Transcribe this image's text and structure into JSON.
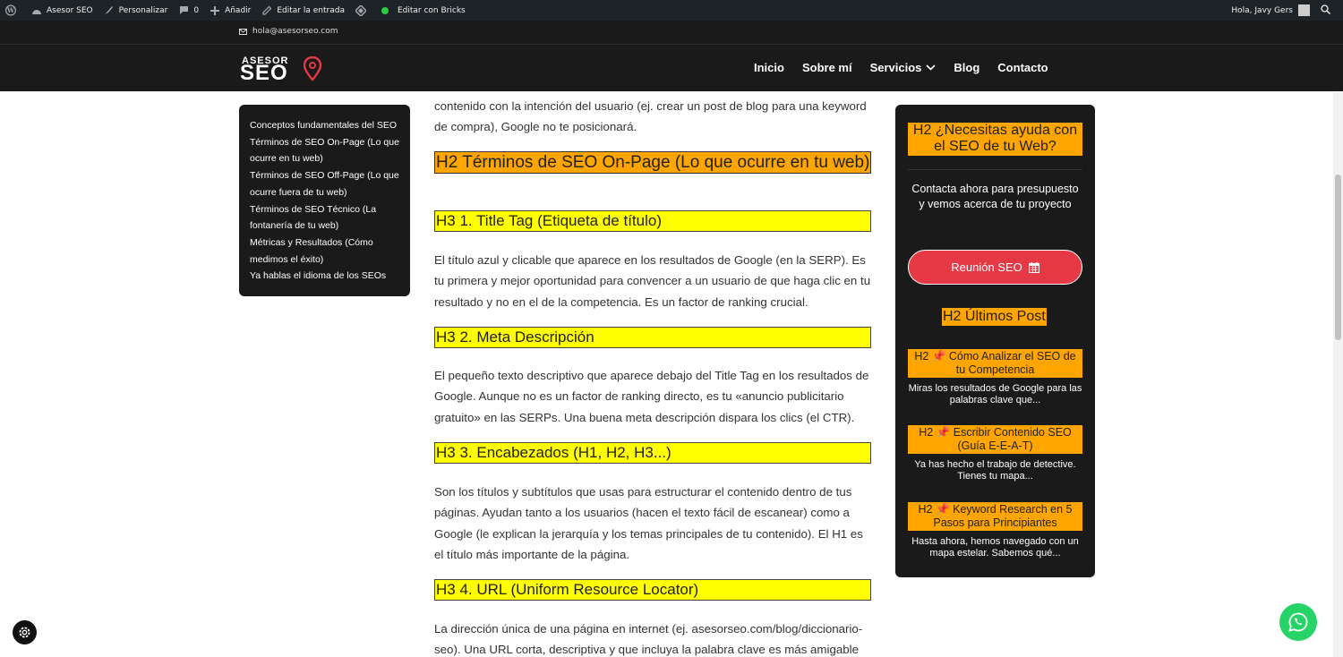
{
  "admin_bar": {
    "site_name": "Asesor SEO",
    "customize": "Personalizar",
    "comments_count": "0",
    "add_new": "Añadir",
    "edit_post": "Editar la entrada",
    "edit_bricks": "Editar con Bricks",
    "greeting": "Hola, Javy Gers"
  },
  "header": {
    "email": "hola@asesorseo.com",
    "logo_top": "ASESOR",
    "logo_bottom": "SEO",
    "nav": [
      "Inicio",
      "Sobre mí",
      "Servicios",
      "Blog",
      "Contacto"
    ]
  },
  "toc": {
    "items": [
      "Conceptos fundamentales del SEO",
      "Términos de SEO On-Page (Lo que ocurre en tu web)",
      "Términos de SEO Off-Page (Lo que ocurre fuera de tu web)",
      "Términos de SEO Técnico (La fontanería de tu web)",
      "Métricas y Resultados (Cómo medimos el éxito)",
      "Ya hablas el idioma de los SEOs"
    ]
  },
  "article": {
    "intro_line1": "contenido con la intención del usuario (ej. crear un post de blog para una keyword",
    "intro_line2": "de compra), Google no te posicionará.",
    "h2_onpage": "H2 Términos de SEO On-Page (Lo que ocurre en tu web)",
    "h3_title_tag": "H3 1. Title Tag (Etiqueta de título)",
    "p_title_tag": "El título azul y clicable que aparece en los resultados de Google (en la SERP). Es tu primera y mejor oportunidad para convencer a un usuario de que haga clic en tu resultado y no en el de la competencia. Es un factor de ranking crucial.",
    "h3_meta": "H3 2. Meta Descripción",
    "p_meta": "El pequeño texto descriptivo que aparece debajo del Title Tag en los resultados de Google. Aunque no es un factor de ranking directo, es tu «anuncio publicitario gratuito» en las SERPs. Una buena meta descripción dispara los clics (el CTR).",
    "h3_headings": "H3 3. Encabezados (H1, H2, H3...)",
    "p_headings": "Son los títulos y subtítulos que usas para estructurar el contenido dentro de tus páginas. Ayudan tanto a los usuarios (hacen el texto fácil de escanear) como a Google (le explican la jerarquía y los temas principales de tu contenido). El H1 es el título más importante de la página.",
    "h3_url": "H3 4. URL (Uniform Resource Locator)",
    "p_url": "La dirección única de una página en internet (ej. asesorseo.com/blog/diccionario-seo). Una URL corta, descriptiva y que incluya la palabra clave es más amigable"
  },
  "sidebar": {
    "cta_heading": "H2 ¿Necesitas ayuda con el SEO de tu Web?",
    "cta_text": "Contacta ahora para presupuesto y vemos acerca de tu proyecto",
    "cta_button": "Reunión SEO",
    "posts_heading": "H2 Últimos Post",
    "posts": [
      {
        "prefix": "H2",
        "pin": "📌",
        "title": "Cómo Analizar el SEO de tu Competencia",
        "excerpt": "Miras los resultados de Google para las palabras clave que..."
      },
      {
        "prefix": "H2",
        "pin": "📌",
        "title": "Escribir Contenido SEO (Guía E-E-A-T)",
        "excerpt": "Ya has hecho el trabajo de detective. Tienes tu mapa..."
      },
      {
        "prefix": "H2",
        "pin": "📌",
        "title": "Keyword Research en 5 Pasos para Principiantes",
        "excerpt": "Hasta ahora, hemos navegado con un mapa estelar. Sabemos qué..."
      }
    ]
  },
  "colors": {
    "h2_bg": "#ffa500",
    "h3_bg": "#ffff00",
    "cta_button": "#e63946",
    "whatsapp": "#25d366",
    "dark": "#1a1a1a"
  }
}
